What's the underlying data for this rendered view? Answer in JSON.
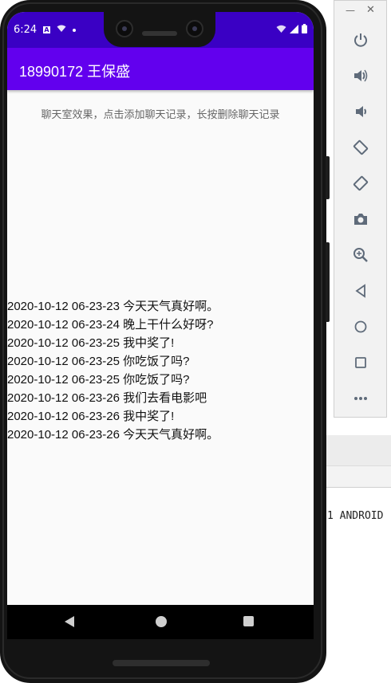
{
  "status_bar": {
    "time": "6:24"
  },
  "app_bar": {
    "title": "18990172 王保盛"
  },
  "hint_text": "聊天室效果，点击添加聊天记录，长按删除聊天记录",
  "chat_records": [
    "2020-10-12 06-23-23 今天天气真好啊。",
    "2020-10-12 06-23-24 晚上干什么好呀?",
    "2020-10-12 06-23-25 我中奖了!",
    "2020-10-12 06-23-25 你吃饭了吗?",
    "2020-10-12 06-23-25 你吃饭了吗?",
    "2020-10-12 06-23-26 我们去看电影吧",
    "2020-10-12 06-23-26 我中奖了!",
    "2020-10-12 06-23-26 今天天气真好啊。"
  ],
  "ide_console_text": "1 ANDROID",
  "emulator_toolbar": {
    "window_controls": [
      "minimize-icon",
      "close-icon"
    ],
    "buttons": [
      "power-icon",
      "volume-up-icon",
      "volume-down-icon",
      "rotate-left-icon",
      "rotate-right-icon",
      "camera-icon",
      "zoom-icon",
      "back-icon",
      "home-icon",
      "overview-icon",
      "more-icon"
    ]
  },
  "colors": {
    "status_bar": "#3a00c4",
    "app_bar": "#6200ee",
    "screen_bg": "#fafafa"
  }
}
